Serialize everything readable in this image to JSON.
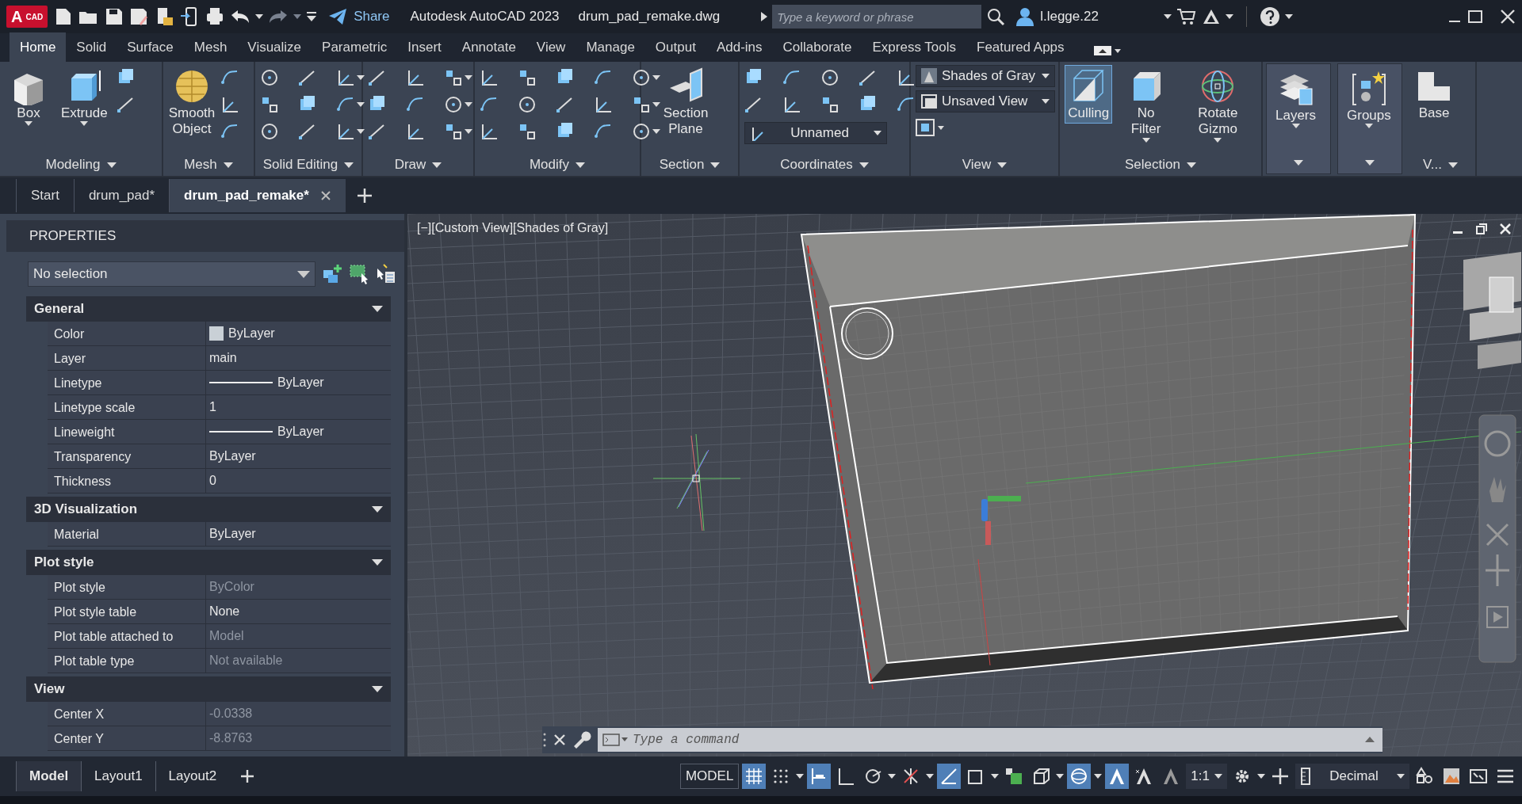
{
  "title_bar": {
    "logo": "A",
    "logo_sub": "CAD",
    "share": "Share",
    "app_title": "Autodesk AutoCAD 2023",
    "file_name": "drum_pad_remake.dwg",
    "search": {
      "placeholder": "Type a keyword or phrase"
    },
    "user": "l.legge.22"
  },
  "ribbon_tabs": [
    {
      "label": "Home",
      "selected": true
    },
    {
      "label": "Solid",
      "selected": false
    },
    {
      "label": "Surface",
      "selected": false
    },
    {
      "label": "Mesh",
      "selected": false
    },
    {
      "label": "Visualize",
      "selected": false
    },
    {
      "label": "Parametric",
      "selected": false
    },
    {
      "label": "Insert",
      "selected": false
    },
    {
      "label": "Annotate",
      "selected": false
    },
    {
      "label": "View",
      "selected": false
    },
    {
      "label": "Manage",
      "selected": false
    },
    {
      "label": "Output",
      "selected": false
    },
    {
      "label": "Add-ins",
      "selected": false
    },
    {
      "label": "Collaborate",
      "selected": false
    },
    {
      "label": "Express Tools",
      "selected": false
    },
    {
      "label": "Featured Apps",
      "selected": false
    }
  ],
  "ribbon_panels": [
    {
      "title": "Modeling",
      "large_buttons": [
        {
          "label": "Box",
          "selected": false
        },
        {
          "label": "Extrude",
          "selected": false
        }
      ]
    },
    {
      "title": "Mesh",
      "large_buttons": [
        {
          "label": "Smooth Object",
          "selected": false
        }
      ]
    },
    {
      "title": "Solid Editing"
    },
    {
      "title": "Draw"
    },
    {
      "title": "Modify"
    },
    {
      "title": "Section",
      "large_buttons": [
        {
          "label": "Section Plane",
          "selected": false
        }
      ]
    },
    {
      "title": "Coordinates",
      "dropdowns": [
        "Unnamed"
      ]
    },
    {
      "title": "View",
      "dropdowns": [
        "Shades of Gray",
        "Unsaved View"
      ]
    },
    {
      "title": "Selection",
      "large_buttons": [
        {
          "label": "Culling",
          "selected": true
        },
        {
          "label": "No Filter",
          "selected": false
        },
        {
          "label": "Rotate Gizmo",
          "selected": false
        }
      ]
    },
    {
      "large_buttons": [
        {
          "label": "Layers",
          "selected": false
        }
      ]
    },
    {
      "large_buttons": [
        {
          "label": "Groups",
          "selected": false
        }
      ]
    },
    {
      "title": "V...",
      "large_buttons": [
        {
          "label": "Base",
          "selected": false
        }
      ]
    }
  ],
  "doc_tabs": [
    {
      "label": "Start",
      "selected": false
    },
    {
      "label": "drum_pad*",
      "selected": false
    },
    {
      "label": "drum_pad_remake*",
      "selected": true
    }
  ],
  "properties": {
    "title": "PROPERTIES",
    "selection": "No selection",
    "sections": [
      {
        "title": "General",
        "rows": [
          {
            "label": "Color",
            "value": "ByLayer",
            "kind": "color",
            "disabled": false
          },
          {
            "label": "Layer",
            "value": "main",
            "kind": "text",
            "disabled": false
          },
          {
            "label": "Linetype",
            "value": "ByLayer",
            "kind": "line",
            "disabled": false
          },
          {
            "label": "Linetype scale",
            "value": "1",
            "kind": "text",
            "disabled": false
          },
          {
            "label": "Lineweight",
            "value": "ByLayer",
            "kind": "line",
            "disabled": false
          },
          {
            "label": "Transparency",
            "value": "ByLayer",
            "kind": "text",
            "disabled": false
          },
          {
            "label": "Thickness",
            "value": "0",
            "kind": "text",
            "disabled": false
          }
        ]
      },
      {
        "title": "3D Visualization",
        "rows": [
          {
            "label": "Material",
            "value": "ByLayer",
            "kind": "text",
            "disabled": false
          }
        ]
      },
      {
        "title": "Plot style",
        "rows": [
          {
            "label": "Plot style",
            "value": "ByColor",
            "kind": "text",
            "disabled": true
          },
          {
            "label": "Plot style table",
            "value": "None",
            "kind": "text",
            "disabled": false
          },
          {
            "label": "Plot table attached to",
            "value": "Model",
            "kind": "text",
            "disabled": true
          },
          {
            "label": "Plot table type",
            "value": "Not available",
            "kind": "text",
            "disabled": true
          }
        ]
      },
      {
        "title": "View",
        "rows": [
          {
            "label": "Center X",
            "value": "-0.0338",
            "kind": "text",
            "disabled": true
          },
          {
            "label": "Center Y",
            "value": "-8.8763",
            "kind": "text",
            "disabled": true
          }
        ]
      }
    ]
  },
  "viewport": {
    "label": "[−][Custom View][Shades of Gray]"
  },
  "command_line": {
    "placeholder": "Type a command"
  },
  "layout_tabs": [
    {
      "label": "Model",
      "selected": true
    },
    {
      "label": "Layout1",
      "selected": false
    },
    {
      "label": "Layout2",
      "selected": false
    }
  ],
  "status_bar": [
    {
      "kind": "text",
      "label": "MODEL"
    },
    {
      "kind": "toggle",
      "on": true
    },
    {
      "kind": "toggle",
      "on": false
    },
    {
      "kind": "toggle",
      "on": true
    },
    {
      "kind": "toggle",
      "on": false
    },
    {
      "kind": "toggle",
      "on": false
    },
    {
      "kind": "toggle",
      "on": false
    },
    {
      "kind": "toggle",
      "on": true
    },
    {
      "kind": "toggle",
      "on": false
    },
    {
      "kind": "toggle",
      "on": false
    },
    {
      "kind": "toggle",
      "on": false
    },
    {
      "kind": "toggle",
      "on": true
    },
    {
      "kind": "toggle",
      "on": true
    },
    {
      "kind": "toggle",
      "on": false
    },
    {
      "kind": "toggle",
      "on": false
    },
    {
      "kind": "dropdown",
      "label": "1:1"
    },
    {
      "kind": "toggle",
      "on": false
    },
    {
      "kind": "toggle",
      "on": false
    },
    {
      "kind": "dropdown",
      "label": "Decimal"
    },
    {
      "kind": "toggle",
      "on": false
    },
    {
      "kind": "toggle",
      "on": false
    },
    {
      "kind": "toggle",
      "on": false
    },
    {
      "kind": "toggle",
      "on": false
    }
  ]
}
